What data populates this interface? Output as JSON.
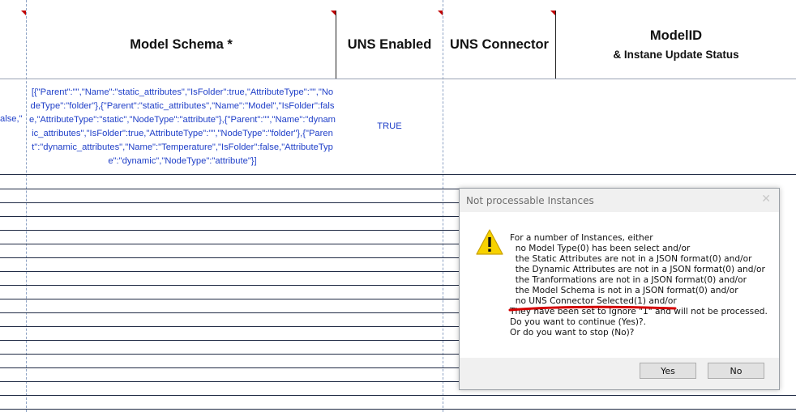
{
  "header": {
    "model_schema": "Model Schema *",
    "uns_enabled": "UNS Enabled",
    "uns_connector": "UNS Connector",
    "model_id": "ModelID",
    "model_id_sub": "& Instane Update Status"
  },
  "row": {
    "left_fragment": "alse,\"",
    "model_schema_json": "[{\"Parent\":\"\",\"Name\":\"static_attributes\",\"IsFolder\":true,\"AttributeType\":\"\",\"NodeType\":\"folder\"},{\"Parent\":\"static_attributes\",\"Name\":\"Model\",\"IsFolder\":false,\"AttributeType\":\"static\",\"NodeType\":\"attribute\"},{\"Parent\":\"\",\"Name\":\"dynamic_attributes\",\"IsFolder\":true,\"AttributeType\":\"\",\"NodeType\":\"folder\"},{\"Parent\":\"dynamic_attributes\",\"Name\":\"Temperature\",\"IsFolder\":false,\"AttributeType\":\"dynamic\",\"NodeType\":\"attribute\"}]",
    "uns_enabled": "TRUE"
  },
  "dialog": {
    "title": "Not processable Instances",
    "close_glyph": "✕",
    "lines": [
      "For a number of Instances, either",
      "  no Model Type(0) has been select and/or",
      "  the Static Attributes are not in a JSON format(0) and/or",
      "  the Dynamic Attributes are not in a JSON format(0) and/or",
      "  the Tranformations are not in a JSON format(0) and/or",
      "  the Model Schema is not in a JSON format(0) and/or",
      "  no UNS Connector Selected(1) and/or",
      "They have been set to Ignore \"1\" and will not be processed.",
      "Do you want to continue (Yes)?.",
      "Or do you want to stop (No)?"
    ],
    "yes_label": "Yes",
    "no_label": "No",
    "icon": "warning-icon"
  },
  "colors": {
    "cell_text": "#1f3fc8",
    "note_marker": "#c00000",
    "annotation_red": "#d40000"
  }
}
